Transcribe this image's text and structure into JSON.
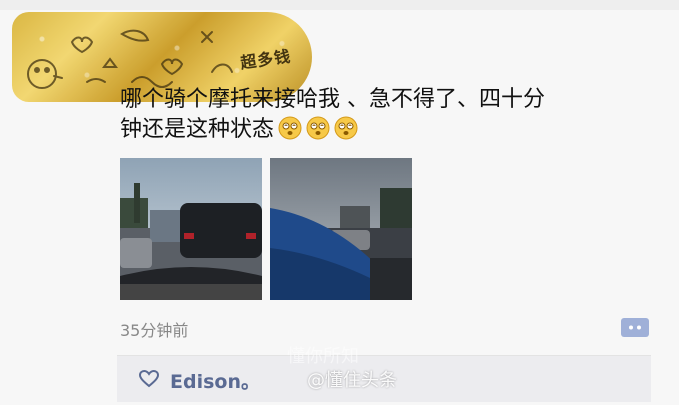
{
  "avatar": {
    "sticker_text": "超多钱"
  },
  "post": {
    "line1": "哪个骑个摩托来接哈我 、急不得了、四十分",
    "line2": "钟还是这种状态",
    "emoji_name": "dizzy-face-emoji",
    "emoji_count": 3
  },
  "photos": [
    {
      "description_icon": "traffic-jam-photo"
    },
    {
      "description_icon": "traffic-jam-photo"
    }
  ],
  "meta": {
    "timestamp": "35分钟前"
  },
  "likes": {
    "names": "Edison。"
  },
  "watermark": {
    "text": "@懂住头条",
    "faded_text": "懂你所知"
  },
  "colors": {
    "like_name": "#5a6a93",
    "comment_button": "#9fb0d8",
    "gold": "#d9b43a"
  }
}
